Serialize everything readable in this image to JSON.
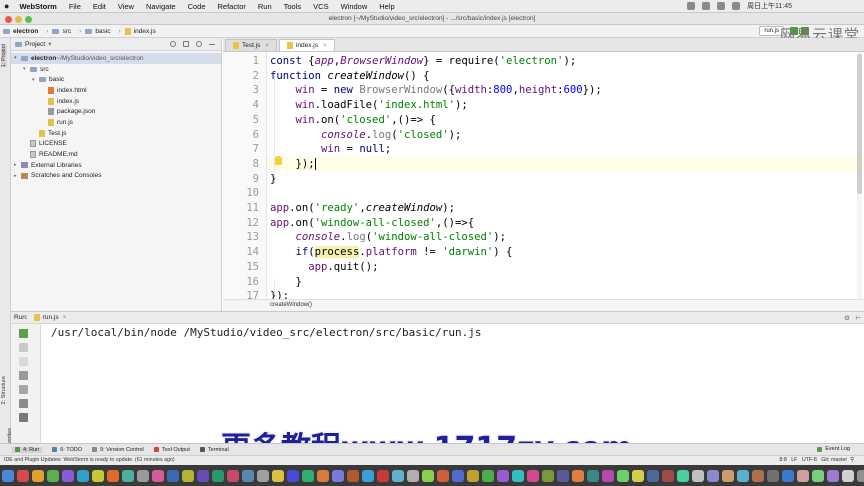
{
  "menubar": {
    "apple": "",
    "app": "WebStorm",
    "items": [
      "File",
      "Edit",
      "View",
      "Navigate",
      "Code",
      "Refactor",
      "Run",
      "Tools",
      "VCS",
      "Window",
      "Help"
    ],
    "clock": "周日上午11:45"
  },
  "window": {
    "title": "electron [~/MyStudio/video_src/electron] - .../src/basic/index.js [electron]"
  },
  "navbar": {
    "crumbs": [
      "electron",
      "src",
      "basic",
      "index.js"
    ],
    "run_config": "run.js"
  },
  "watermark": "网易云课堂",
  "project_panel": {
    "title": "Project",
    "tree": [
      {
        "label": "electron",
        "suffix": " ~/MyStudio/video_src/electron",
        "icon": "folder",
        "level": 0,
        "expanded": true
      },
      {
        "label": "src",
        "icon": "folder",
        "level": 1,
        "expanded": true
      },
      {
        "label": "basic",
        "icon": "folder",
        "level": 2,
        "expanded": true
      },
      {
        "label": "index.html",
        "icon": "html",
        "level": 3
      },
      {
        "label": "index.js",
        "icon": "js",
        "level": 3
      },
      {
        "label": "package.json",
        "icon": "json",
        "level": 3
      },
      {
        "label": "run.js",
        "icon": "js",
        "level": 3
      },
      {
        "label": "Test.js",
        "icon": "js",
        "level": 2
      },
      {
        "label": "LICENSE",
        "icon": "txt",
        "level": 1
      },
      {
        "label": "README.md",
        "icon": "txt",
        "level": 1
      },
      {
        "label": "External Libraries",
        "icon": "lib",
        "level": 0
      },
      {
        "label": "Scratches and Consoles",
        "icon": "scr",
        "level": 0
      }
    ]
  },
  "left_strip": {
    "project": "1: Project",
    "structure": "2: Structure",
    "favorites": "2: Favorites"
  },
  "editor": {
    "tabs": [
      {
        "label": "Test.js",
        "active": false
      },
      {
        "label": "index.js",
        "active": true
      }
    ],
    "line_numbers": [
      "1",
      "2",
      "3",
      "4",
      "5",
      "6",
      "7",
      "8",
      "9",
      "10",
      "11",
      "12",
      "13",
      "14",
      "15",
      "16",
      "17"
    ],
    "breadcrumb": "createWindow()"
  },
  "run_panel": {
    "label": "Run:",
    "tab": "run.js",
    "output": "/usr/local/bin/node /MyStudio/video_src/electron/src/basic/run.js"
  },
  "overlay_text": "更多教程www.1717zy.com",
  "bottom_tools": [
    {
      "label": "4: Run",
      "color": "#4a9a4a"
    },
    {
      "label": "6: TODO",
      "color": "#5a7ab4"
    },
    {
      "label": "9: Version Control",
      "color": "#888888"
    },
    {
      "label": "Tool Output",
      "color": "#c84a3a"
    },
    {
      "label": "Terminal",
      "color": "#555555"
    }
  ],
  "event_log": "Event Log",
  "status": {
    "message": "IDE and Plugin Updates: WebStorm is ready to update. (61 minutes ago)",
    "position": "8:8",
    "line_sep": "LF",
    "encoding": "UTF-8",
    "vcs": "Git: master"
  }
}
